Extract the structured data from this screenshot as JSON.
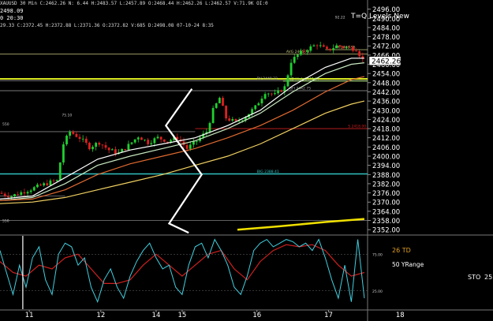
{
  "header": {
    "line1": "XAUUSD 30 Min  C:2462.26  N: 6.44  H:2483.57  L:2457.89  O:2468.44  H:2462.26  L:2462.57  V:71.9K  OI:0",
    "line2": "2498.09",
    "line3": "0 20:30",
    "line4": "29.33  C:2372.45  H:2372.88  L:2371.36  O:2372.82  V:685  D:2498.08  07-10-24 8:35"
  },
  "chart_data": {
    "type": "candlestick",
    "title": "T=Q Levels New",
    "price_axis": {
      "ylim": [
        2349,
        2502
      ],
      "ticks": [
        2496.0,
        2490.0,
        2484.0,
        2478.0,
        2472.0,
        2466.0,
        2460.0,
        2454.0,
        2448.0,
        2442.0,
        2436.0,
        2430.0,
        2424.0,
        2418.0,
        2412.0,
        2406.0,
        2400.0,
        2394.0,
        2388.0,
        2382.0,
        2376.0,
        2370.0,
        2364.0,
        2358.0,
        2352.0
      ],
      "tick_labels": [
        "2496.00",
        "2490.00",
        "2484.00",
        "2478.00",
        "2472.00",
        "2466.00",
        "2460.00",
        "2454.00",
        "2448.00",
        "2442.00",
        "2436.00",
        "2430.00",
        "2424.00",
        "2418.00",
        "2412.00",
        "2406.00",
        "2400.00",
        "2394.00",
        "2388.00",
        "2382.00",
        "2376.00",
        "2370.00",
        "2364.00",
        "2358.00",
        "2352.00"
      ],
      "last_price_label": "2462.26",
      "last_price": 2462.26
    },
    "x_axis": {
      "range": [
        0,
        100
      ],
      "ticks": [
        {
          "x": 9,
          "label": "11"
        },
        {
          "x": 31,
          "label": "12"
        },
        {
          "x": 48,
          "label": "14"
        },
        {
          "x": 56,
          "label": "15"
        },
        {
          "x": 79,
          "label": "16"
        },
        {
          "x": 101,
          "label": "17"
        },
        {
          "x": 123,
          "label": "18"
        }
      ]
    },
    "ohlc_anchor": [
      [
        0,
        2376
      ],
      [
        4,
        2374
      ],
      [
        8,
        2377
      ],
      [
        12,
        2380
      ],
      [
        16,
        2383
      ],
      [
        18,
        2384
      ],
      [
        20,
        2408
      ],
      [
        22,
        2416
      ],
      [
        25,
        2412
      ],
      [
        28,
        2406
      ],
      [
        31,
        2409
      ],
      [
        34,
        2404
      ],
      [
        37,
        2402
      ],
      [
        40,
        2407
      ],
      [
        43,
        2413
      ],
      [
        46,
        2409
      ],
      [
        49,
        2412
      ],
      [
        52,
        2410
      ],
      [
        55,
        2412
      ],
      [
        58,
        2405
      ],
      [
        61,
        2410
      ],
      [
        64,
        2416
      ],
      [
        66,
        2430
      ],
      [
        68,
        2438
      ],
      [
        70,
        2425
      ],
      [
        73,
        2422
      ],
      [
        76,
        2426
      ],
      [
        79,
        2432
      ],
      [
        82,
        2442
      ],
      [
        85,
        2440
      ],
      [
        88,
        2445
      ],
      [
        90,
        2462
      ],
      [
        92,
        2466
      ],
      [
        95,
        2470
      ],
      [
        98,
        2473
      ],
      [
        101,
        2469
      ],
      [
        104,
        2472
      ],
      [
        107,
        2471
      ],
      [
        110,
        2470
      ],
      [
        112,
        2463
      ]
    ],
    "moving_averages": [
      {
        "color": "#ffffff",
        "points": [
          [
            0,
            2372
          ],
          [
            10,
            2374
          ],
          [
            20,
            2386
          ],
          [
            30,
            2398
          ],
          [
            40,
            2404
          ],
          [
            50,
            2408
          ],
          [
            60,
            2412
          ],
          [
            70,
            2420
          ],
          [
            80,
            2430
          ],
          [
            90,
            2446
          ],
          [
            100,
            2458
          ],
          [
            108,
            2464
          ],
          [
            112,
            2464
          ]
        ]
      },
      {
        "color": "#c8e8c0",
        "points": [
          [
            0,
            2371
          ],
          [
            10,
            2373
          ],
          [
            20,
            2382
          ],
          [
            30,
            2394
          ],
          [
            40,
            2400
          ],
          [
            50,
            2405
          ],
          [
            60,
            2410
          ],
          [
            70,
            2418
          ],
          [
            80,
            2428
          ],
          [
            90,
            2442
          ],
          [
            100,
            2454
          ],
          [
            108,
            2460
          ],
          [
            112,
            2461
          ]
        ]
      },
      {
        "color": "#e06a30",
        "points": [
          [
            0,
            2371
          ],
          [
            10,
            2372
          ],
          [
            20,
            2378
          ],
          [
            30,
            2388
          ],
          [
            40,
            2395
          ],
          [
            50,
            2400
          ],
          [
            60,
            2405
          ],
          [
            70,
            2412
          ],
          [
            80,
            2420
          ],
          [
            90,
            2430
          ],
          [
            100,
            2442
          ],
          [
            108,
            2450
          ],
          [
            112,
            2452
          ]
        ]
      },
      {
        "color": "#f0d060",
        "points": [
          [
            0,
            2369
          ],
          [
            10,
            2370
          ],
          [
            20,
            2373
          ],
          [
            30,
            2378
          ],
          [
            40,
            2383
          ],
          [
            50,
            2388
          ],
          [
            60,
            2394
          ],
          [
            70,
            2400
          ],
          [
            80,
            2408
          ],
          [
            90,
            2418
          ],
          [
            100,
            2428
          ],
          [
            108,
            2434
          ],
          [
            112,
            2436
          ]
        ]
      },
      {
        "color": "#f0e000",
        "width": 2.5,
        "points": [
          [
            73,
            2352
          ],
          [
            85,
            2354
          ],
          [
            100,
            2357
          ],
          [
            112,
            2359
          ]
        ]
      }
    ],
    "levels": [
      {
        "price": 2466.7,
        "color": "#c8c880",
        "label": "AVG 2466.70",
        "x1": 0,
        "x2": 113,
        "lx": 88
      },
      {
        "price": 2469.56,
        "color": "#c8c880",
        "label": "FR 2469.56",
        "x1": 100,
        "x2": 113,
        "lx": 103
      },
      {
        "price": 2450.5,
        "color": "#d8e820",
        "label": "",
        "x1": 0,
        "x2": 113,
        "lx": 0,
        "width": 2
      },
      {
        "price": 2449.32,
        "color": "#a0a0a0",
        "label": "BV 2449.32",
        "x1": 0,
        "x2": 113,
        "lx": 79
      },
      {
        "price": 2449.04,
        "color": "#a0e060",
        "label": "LD High 2449.04",
        "x1": 87,
        "x2": 113,
        "lx": 89
      },
      {
        "price": 2442.75,
        "color": "#a0a0a0",
        "label": "BFI 2442.75",
        "x1": 0,
        "x2": 113,
        "lx": 89
      },
      {
        "price": 2418.0,
        "color": "#d02020",
        "label": "S 2418.00",
        "x1": 60,
        "x2": 113,
        "lx": 107
      },
      {
        "price": 2388.41,
        "color": "#30c0c0",
        "label": "BIG 2388.41",
        "x1": 0,
        "x2": 113,
        "lx": 79,
        "width": 1.5
      },
      {
        "price": 2416.0,
        "color": "#808080",
        "label": "",
        "x1": 0,
        "x2": 60,
        "lx": 0
      },
      {
        "price": 2374.0,
        "color": "#808080",
        "label": "",
        "x1": 0,
        "x2": 20,
        "lx": 0
      },
      {
        "price": 2358.0,
        "color": "#808080",
        "label": "",
        "x1": 0,
        "x2": 113,
        "lx": 0
      }
    ],
    "annotations": [
      {
        "x": 19,
        "price": 2426,
        "text": "75.10"
      },
      {
        "x": 103,
        "price": 2490,
        "text": "92.22"
      },
      {
        "x": -1,
        "price": 2420,
        "text": "550"
      },
      {
        "x": -1,
        "price": 2357,
        "text": "550"
      }
    ],
    "zigzag": [
      [
        59,
        2444
      ],
      [
        51,
        2420
      ],
      [
        62,
        2388
      ],
      [
        52,
        2356
      ],
      [
        58,
        2350
      ]
    ],
    "indicator": {
      "label_td": "26 TD",
      "label_yrange": "50 YRange",
      "label_sto": "STO",
      "sto_value": "25",
      "ylim": [
        0,
        100
      ],
      "ticks": [
        {
          "value": 75,
          "label": "75.00"
        },
        {
          "value": 25,
          "label": "25.00"
        }
      ],
      "line_cyan": [
        [
          0,
          80
        ],
        [
          2,
          50
        ],
        [
          4,
          20
        ],
        [
          6,
          60
        ],
        [
          8,
          30
        ],
        [
          10,
          70
        ],
        [
          12,
          85
        ],
        [
          14,
          40
        ],
        [
          16,
          20
        ],
        [
          18,
          75
        ],
        [
          20,
          90
        ],
        [
          22,
          85
        ],
        [
          24,
          60
        ],
        [
          26,
          70
        ],
        [
          28,
          30
        ],
        [
          30,
          10
        ],
        [
          32,
          40
        ],
        [
          34,
          55
        ],
        [
          36,
          30
        ],
        [
          38,
          15
        ],
        [
          40,
          45
        ],
        [
          42,
          65
        ],
        [
          44,
          80
        ],
        [
          46,
          90
        ],
        [
          48,
          70
        ],
        [
          50,
          55
        ],
        [
          52,
          60
        ],
        [
          54,
          30
        ],
        [
          56,
          20
        ],
        [
          58,
          60
        ],
        [
          60,
          85
        ],
        [
          62,
          90
        ],
        [
          64,
          70
        ],
        [
          66,
          95
        ],
        [
          68,
          80
        ],
        [
          70,
          60
        ],
        [
          72,
          30
        ],
        [
          74,
          20
        ],
        [
          76,
          45
        ],
        [
          78,
          80
        ],
        [
          80,
          90
        ],
        [
          82,
          95
        ],
        [
          84,
          85
        ],
        [
          86,
          90
        ],
        [
          88,
          95
        ],
        [
          90,
          92
        ],
        [
          92,
          85
        ],
        [
          94,
          90
        ],
        [
          96,
          80
        ],
        [
          98,
          95
        ],
        [
          100,
          70
        ],
        [
          102,
          40
        ],
        [
          104,
          15
        ],
        [
          106,
          60
        ],
        [
          108,
          10
        ],
        [
          110,
          95
        ],
        [
          112,
          15
        ]
      ],
      "line_red": [
        [
          0,
          65
        ],
        [
          4,
          50
        ],
        [
          8,
          45
        ],
        [
          12,
          60
        ],
        [
          16,
          55
        ],
        [
          20,
          70
        ],
        [
          24,
          75
        ],
        [
          28,
          55
        ],
        [
          32,
          35
        ],
        [
          36,
          35
        ],
        [
          40,
          40
        ],
        [
          44,
          60
        ],
        [
          48,
          75
        ],
        [
          52,
          60
        ],
        [
          56,
          45
        ],
        [
          60,
          60
        ],
        [
          64,
          75
        ],
        [
          68,
          80
        ],
        [
          72,
          55
        ],
        [
          76,
          40
        ],
        [
          80,
          65
        ],
        [
          84,
          80
        ],
        [
          88,
          88
        ],
        [
          92,
          85
        ],
        [
          96,
          88
        ],
        [
          100,
          80
        ],
        [
          104,
          60
        ],
        [
          108,
          45
        ],
        [
          112,
          50
        ]
      ],
      "line_white": [
        [
          7,
          100
        ],
        [
          7,
          0
        ]
      ]
    }
  }
}
